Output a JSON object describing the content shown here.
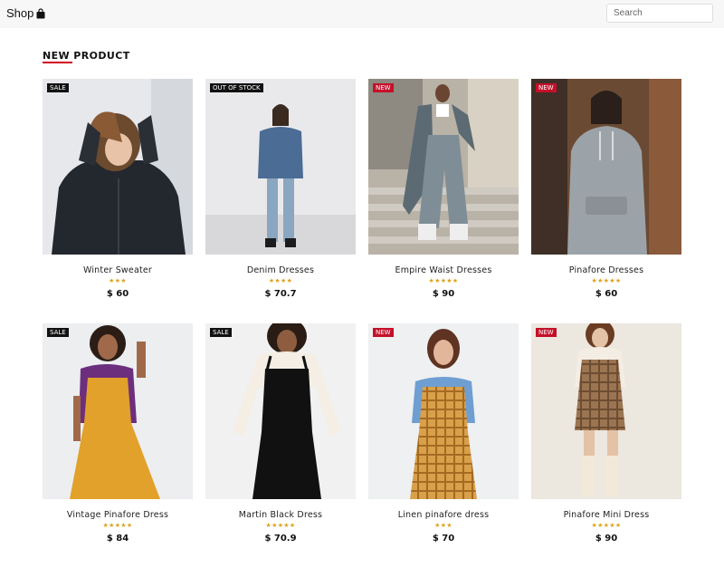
{
  "header": {
    "brand": "Shop",
    "brand_icon": "shopping-bag-icon",
    "search_placeholder": "Search"
  },
  "section": {
    "title": "NEW PRODUCT",
    "accent_color": "#d0021b"
  },
  "colors": {
    "star": "#e0a21b",
    "badge_sale": "#111111",
    "badge_new": "#c4102a"
  },
  "products": [
    {
      "name": "Winter Sweater",
      "badge": "SALE",
      "badge_style": "black",
      "stars": "★★★",
      "price": "$ 60",
      "image": "woman-black-winter-jacket-photo"
    },
    {
      "name": "Denim Dresses",
      "badge": "OUT OF STOCK",
      "badge_style": "black",
      "stars": "★★★★",
      "price": "$ 70.7",
      "image": "woman-denim-puffer-jacket-photo"
    },
    {
      "name": "Empire Waist Dresses",
      "badge": "NEW",
      "badge_style": "red",
      "stars": "★★★★★",
      "price": "$ 90",
      "image": "woman-grey-suit-on-stairs-photo"
    },
    {
      "name": "Pinafore Dresses",
      "badge": "NEW",
      "badge_style": "red",
      "stars": "★★★★★",
      "price": "$ 60",
      "image": "woman-grey-hoodie-photo"
    },
    {
      "name": "Vintage Pinafore Dress",
      "badge": "SALE",
      "badge_style": "black",
      "stars": "★★★★★",
      "price": "$ 84",
      "image": "woman-mustard-pinafore-photo"
    },
    {
      "name": "Martin Black Dress",
      "badge": "SALE",
      "badge_style": "black",
      "stars": "★★★★★",
      "price": "$ 70.9",
      "image": "woman-black-pinafore-photo"
    },
    {
      "name": "Linen pinafore dress",
      "badge": "NEW",
      "badge_style": "red",
      "stars": "★★★",
      "price": "$ 70",
      "image": "woman-plaid-pinafore-photo"
    },
    {
      "name": "Pinafore Mini Dress",
      "badge": "NEW",
      "badge_style": "red",
      "stars": "★★★★★",
      "price": "$ 90",
      "image": "woman-brown-plaid-mini-photo"
    }
  ]
}
